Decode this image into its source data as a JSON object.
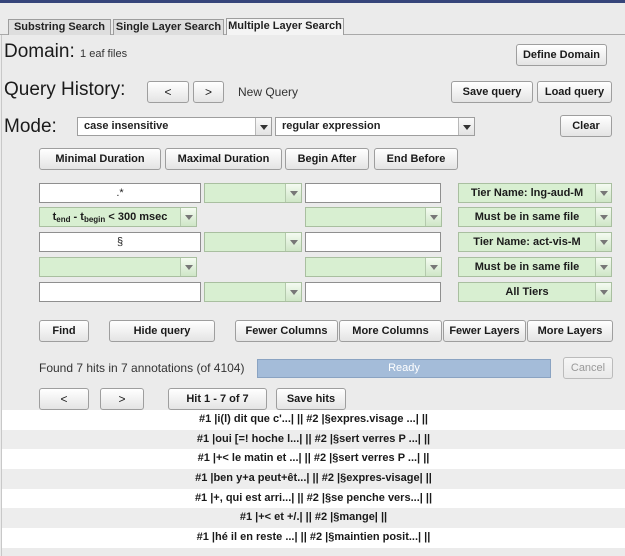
{
  "tabs": [
    {
      "label": "Substring Search",
      "active": false
    },
    {
      "label": "Single Layer Search",
      "active": false
    },
    {
      "label": "Multiple Layer Search",
      "active": true
    }
  ],
  "domain": {
    "label": "Domain:",
    "value": "1 eaf files",
    "button": "Define Domain"
  },
  "history": {
    "label": "Query History:",
    "prev": "<",
    "next": ">",
    "current": "New Query",
    "save": "Save query",
    "load": "Load query"
  },
  "mode": {
    "label": "Mode:",
    "case": "case insensitive",
    "pattern": "regular expression",
    "clear": "Clear"
  },
  "constraint_buttons": {
    "min": "Minimal Duration",
    "max": "Maximal Duration",
    "begin": "Begin After",
    "end": "End Before"
  },
  "query_rows": {
    "r1": {
      "pattern": ".*",
      "tier": "Tier Name: lng-aud-M"
    },
    "r2": {
      "t_end": "t",
      "sub_end": "end",
      "dash": " - t",
      "sub_begin": "begin",
      "cond": " < 300 msec",
      "file": "Must be in same file"
    },
    "r3": {
      "pattern": "§",
      "tier": "Tier Name: act-vis-M"
    },
    "r4": {
      "file": "Must be in same file"
    },
    "r5": {
      "tier": "All Tiers"
    }
  },
  "actions": {
    "find": "Find",
    "hide": "Hide query",
    "fewer_cols": "Fewer Columns",
    "more_cols": "More Columns",
    "fewer_layers": "Fewer Layers",
    "more_layers": "More Layers"
  },
  "status": {
    "found": "Found 7 hits in 7 annotations (of 4104)",
    "progress_label": "Ready",
    "progress": 1.0,
    "cancel": "Cancel"
  },
  "nav": {
    "prev": "<",
    "next": ">",
    "hit_range": "Hit 1 - 7 of 7",
    "save_hits": "Save hits"
  },
  "results": [
    "#1 |i(l) dit que c'...| ||  #2 |§expres.visage ...| ||",
    "#1 |oui [=! hoche l...| ||  #2 |§sert verres P ...| ||",
    "#1 |+< le matin et ...| ||  #2 |§sert verres P ...| ||",
    "#1 |ben y+a peut+êt...| ||  #2 |§expres-visage| ||",
    "#1 |+, qui est arri...| ||  #2 |§se penche vers...| ||",
    "#1 |+< et +/.| ||  #2 |§mange| ||",
    "#1 |hé il en reste ...| ||  #2 |§maintien posit...| ||"
  ]
}
